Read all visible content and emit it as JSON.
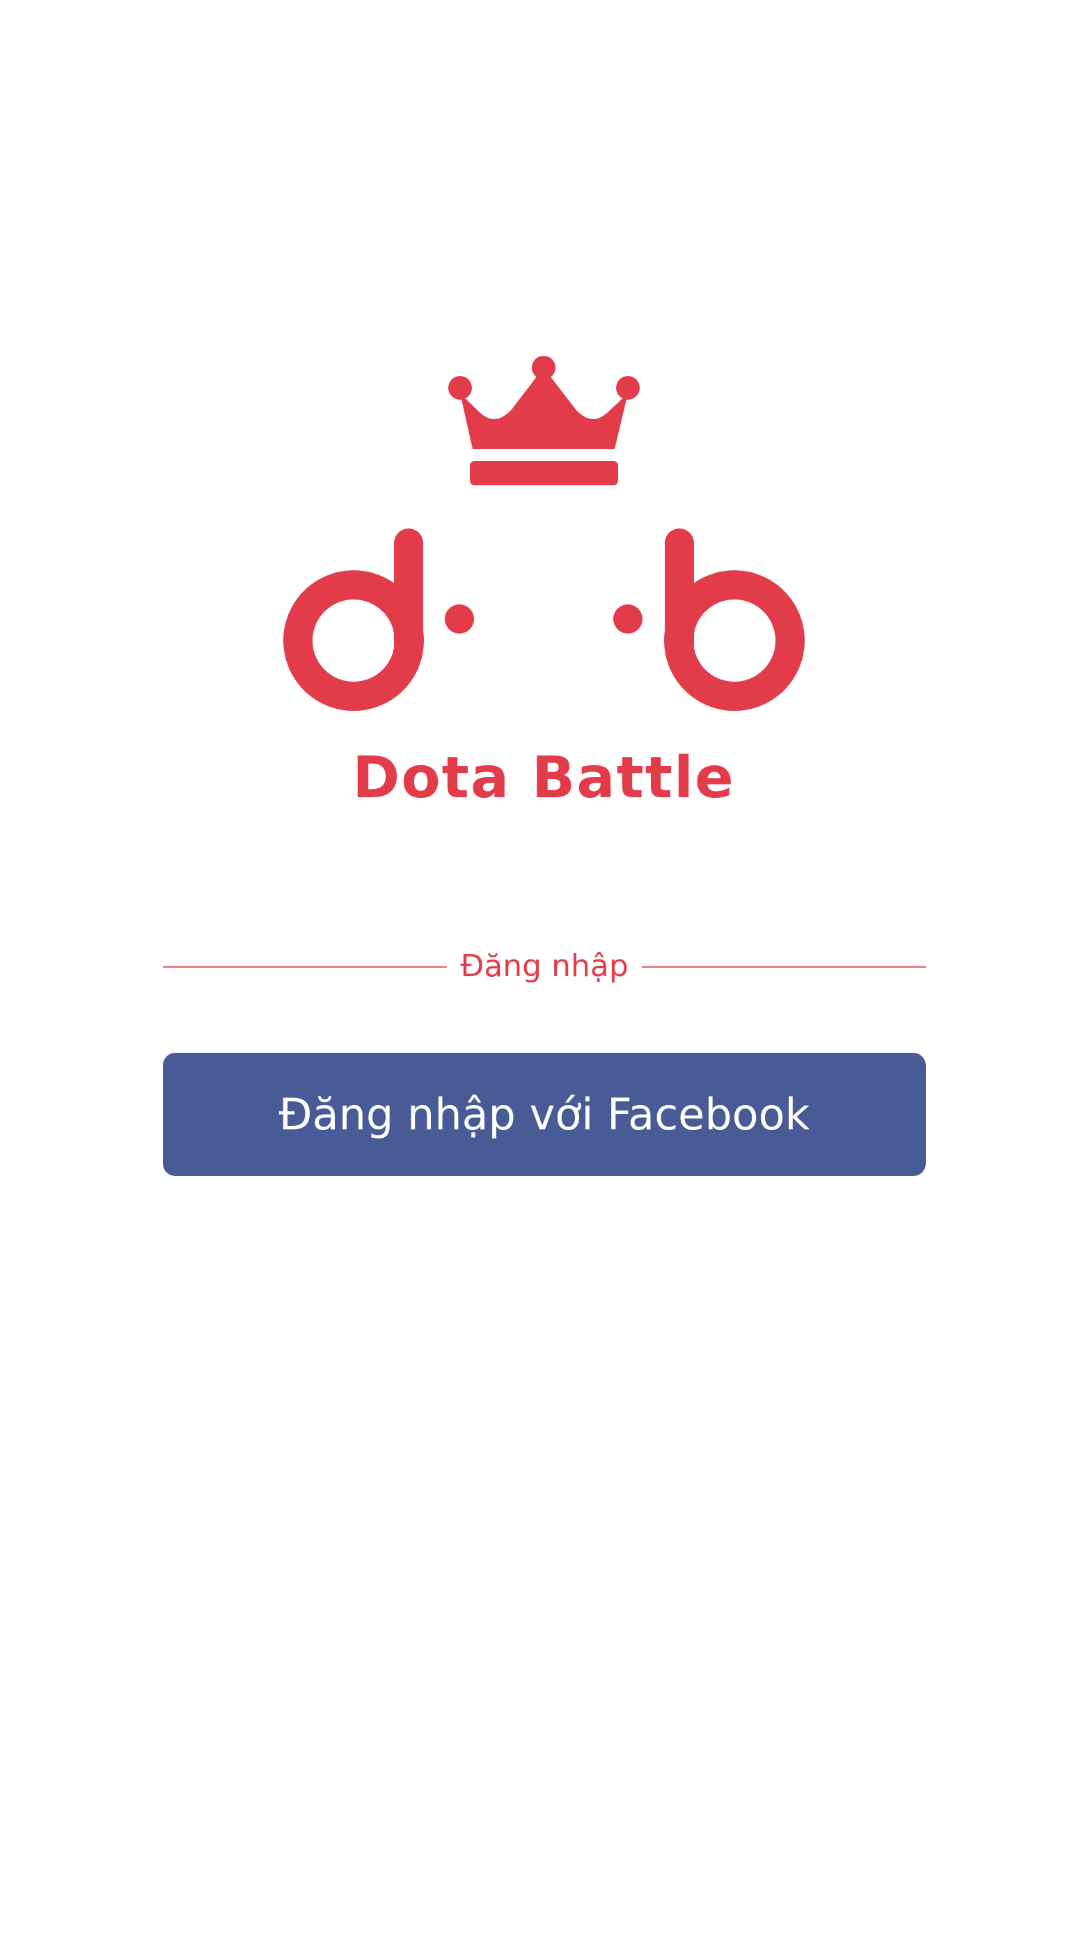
{
  "colors": {
    "brand_red": "#e23b4a",
    "facebook_blue": "#485b96",
    "divider": "#e8838c",
    "background": "#ffffff"
  },
  "logo": {
    "icon_name": "crown-icon",
    "wordmark": "Dota Battle"
  },
  "login": {
    "divider_label": "Đăng nhập",
    "facebook_button_label": "Đăng nhập với Facebook"
  }
}
